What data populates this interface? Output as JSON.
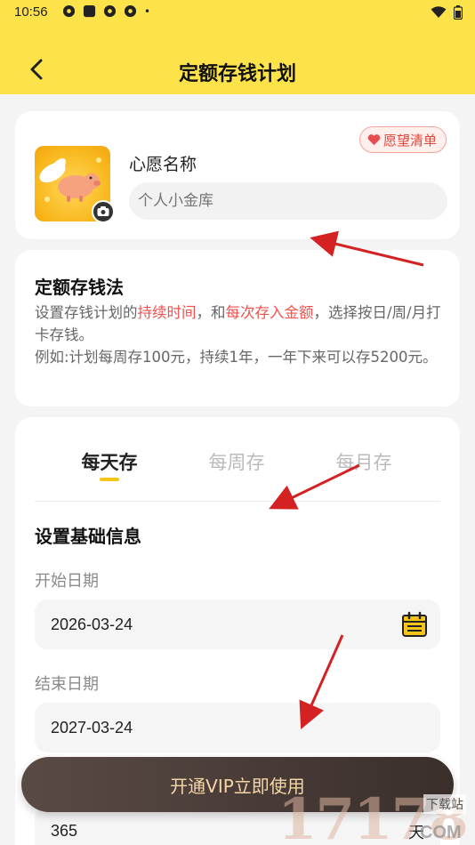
{
  "status_bar": {
    "time": "10:56",
    "dot": "•"
  },
  "header": {
    "title": "定额存钱计划",
    "back_icon": "chevron-left-icon",
    "background": "#fde24a"
  },
  "wish": {
    "name_label": "心愿名称",
    "name_placeholder": "个人小金库",
    "badge_label": "愿望清单",
    "badge_icon": "heart-icon"
  },
  "method": {
    "title": "定额存钱法",
    "desc_1": "设置存钱计划的",
    "desc_hl1": "持续时间",
    "desc_2": "，和",
    "desc_hl2": "每次存入金额",
    "desc_3": "，选择按日/周/月打卡存钱。",
    "example": "例如:计划每周存100元，持续1年，一年下来可以存5200元。",
    "highlight_color": "#f2504b"
  },
  "plan": {
    "tabs": [
      {
        "label": "每天存"
      },
      {
        "label": "每周存"
      },
      {
        "label": "每月存"
      }
    ],
    "active_tab": "每天存",
    "section_title": "设置基础信息",
    "start_label": "开始日期",
    "start_value": "2026-03-24",
    "end_label": "结束日期",
    "end_value": "2027-03-24",
    "days_value": "365",
    "days_unit": "天"
  },
  "vip_button": {
    "label": "开通VIP立即使用"
  },
  "watermark": {
    "number": "17178",
    "site": "下载站",
    "domain": "COM"
  }
}
